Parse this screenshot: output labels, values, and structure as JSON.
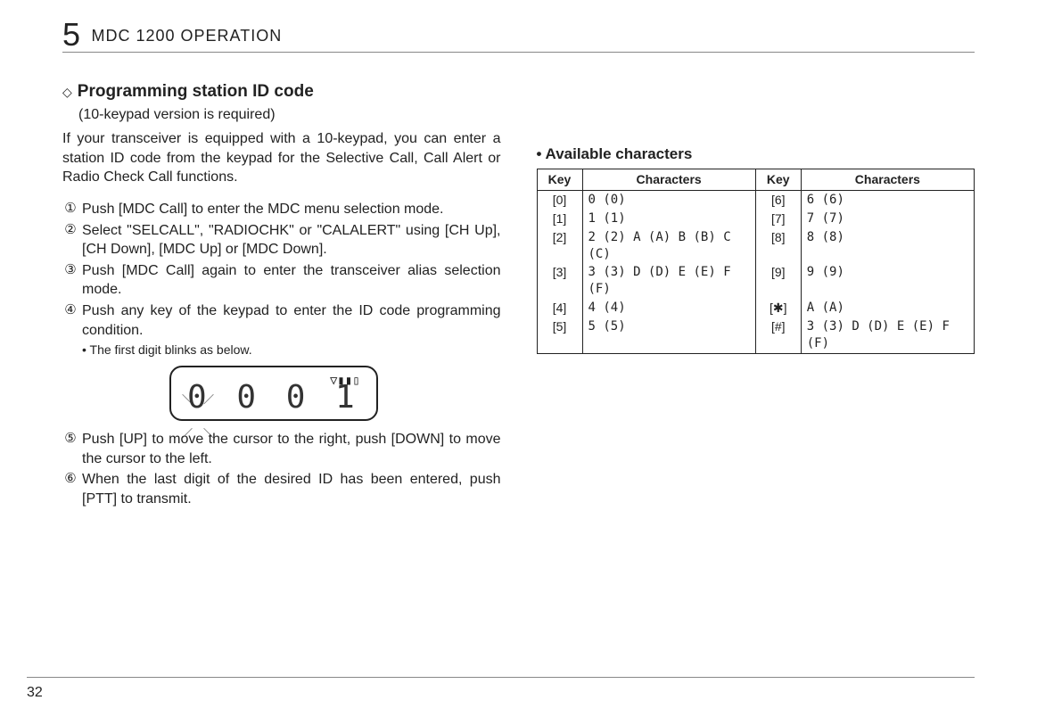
{
  "header": {
    "chapter_number": "5",
    "chapter_title": "MDC 1200 OPERATION"
  },
  "left": {
    "diamond": "◇",
    "heading": "Programming station ID code",
    "subheading": "(10-keypad version is required)",
    "intro": "If your transceiver is equipped with a 10-keypad, you can enter a station ID code from the keypad for the Selective Call, Call Alert or Radio Check Call functions.",
    "steps": [
      {
        "num": "①",
        "text": "Push [MDC Call] to enter the MDC menu selection mode."
      },
      {
        "num": "②",
        "text": "Select \"SELCALL\", \"RADIOCHK\" or \"CALALERT\" using [CH Up], [CH Down], [MDC Up] or [MDC Down]."
      },
      {
        "num": "③",
        "text": "Push [MDC Call] again to enter the transceiver alias selection mode."
      },
      {
        "num": "④",
        "text": "Push any key of the keypad to enter the ID code programming condition."
      }
    ],
    "note": "• The first digit blinks as below.",
    "lcd_antenna": "▽▮▮▯",
    "lcd_digits": "0 0 0 1",
    "steps2": [
      {
        "num": "⑤",
        "text": "Push [UP] to move the cursor to the right, push [DOWN] to move the cursor to the left."
      },
      {
        "num": "⑥",
        "text": "When the last digit of the desired ID has been entered, push [PTT] to transmit."
      }
    ]
  },
  "right": {
    "section_title": "• Available characters",
    "headers": {
      "key": "Key",
      "chars": "Characters"
    },
    "rows_left": [
      {
        "key": "[0]",
        "chars": "0 (0)"
      },
      {
        "key": "[1]",
        "chars": "1 (1)"
      },
      {
        "key": "[2]",
        "chars": "2 (2)  A (A)  B (B)  C (C)"
      },
      {
        "key": "[3]",
        "chars": "3 (3)  D (D)  E (E)  F (F)"
      },
      {
        "key": "[4]",
        "chars": "4 (4)"
      },
      {
        "key": "[5]",
        "chars": "5 (5)"
      }
    ],
    "rows_right": [
      {
        "key": "[6]",
        "chars": "6 (6)"
      },
      {
        "key": "[7]",
        "chars": "7 (7)"
      },
      {
        "key": "[8]",
        "chars": "8 (8)"
      },
      {
        "key": "[9]",
        "chars": "9 (9)"
      },
      {
        "key": "[✱]",
        "chars": "A (A)"
      },
      {
        "key": "[#]",
        "chars": "3 (3)  D (D)  E (E)  F (F)"
      }
    ]
  },
  "page_number": "32"
}
